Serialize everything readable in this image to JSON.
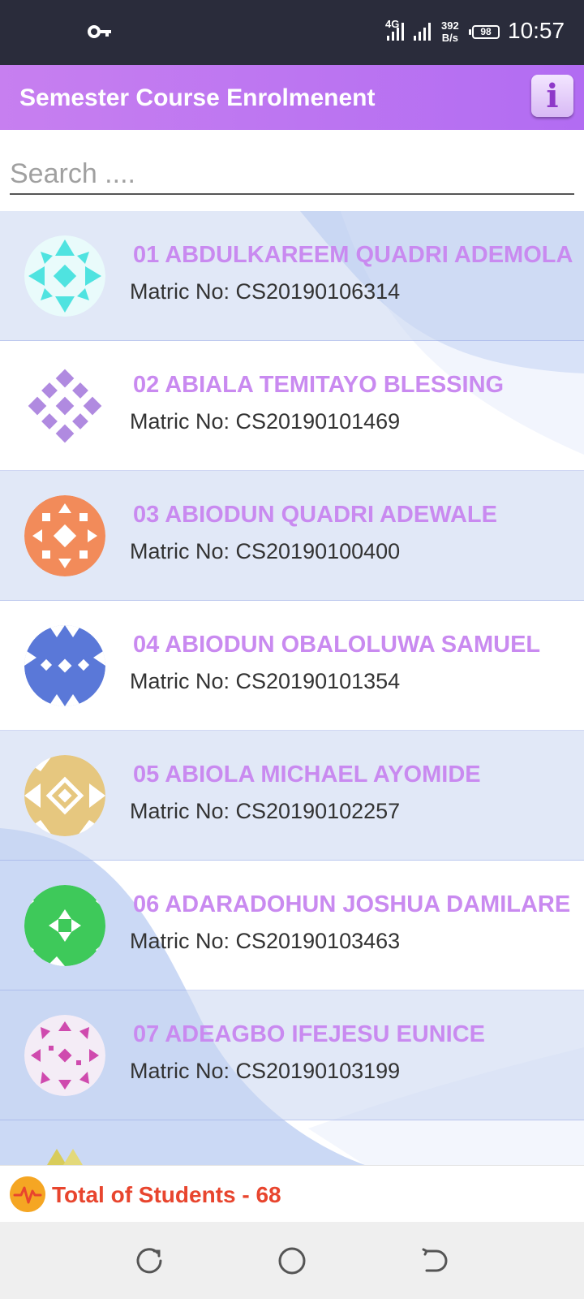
{
  "status_bar": {
    "network": "4G",
    "speed_value": "392",
    "speed_unit": "B/s",
    "battery": "98",
    "time": "10:57"
  },
  "app_bar": {
    "title": "Semester Course Enrolmenent",
    "info_label": "i"
  },
  "search": {
    "placeholder": "Search ...."
  },
  "students": [
    {
      "name": "01 ABDULKAREEM QUADRI ADEMOLA",
      "matric": "Matric No: CS20190106314",
      "avatar_color": "#4fe3e0"
    },
    {
      "name": "02 ABIALA TEMITAYO BLESSING",
      "matric": "Matric No: CS20190101469",
      "avatar_color": "#b08ae0"
    },
    {
      "name": "03 ABIODUN QUADRI ADEWALE",
      "matric": "Matric No: CS20190100400",
      "avatar_color": "#f28b5a"
    },
    {
      "name": "04 ABIODUN OBALOLUWA SAMUEL",
      "matric": "Matric No: CS20190101354",
      "avatar_color": "#5a78d8"
    },
    {
      "name": "05 ABIOLA MICHAEL AYOMIDE",
      "matric": "Matric No: CS20190102257",
      "avatar_color": "#e6c77f"
    },
    {
      "name": "06 ADARADOHUN JOSHUA DAMILARE",
      "matric": "Matric No: CS20190103463",
      "avatar_color": "#3ec95a"
    },
    {
      "name": "07 ADEAGBO IFEJESU EUNICE",
      "matric": "Matric No: CS20190103199",
      "avatar_color": "#cf4aae"
    }
  ],
  "footer": {
    "total_label": "Total of Students - 68",
    "icon": "pulse-icon"
  },
  "nav": {
    "icons": [
      "recent-apps-icon",
      "home-icon",
      "back-icon"
    ]
  },
  "colors": {
    "app_bar": "#b26cf2",
    "name_text": "#c98af0",
    "total_text": "#e8452e",
    "status_bar": "#2a2c3b"
  }
}
